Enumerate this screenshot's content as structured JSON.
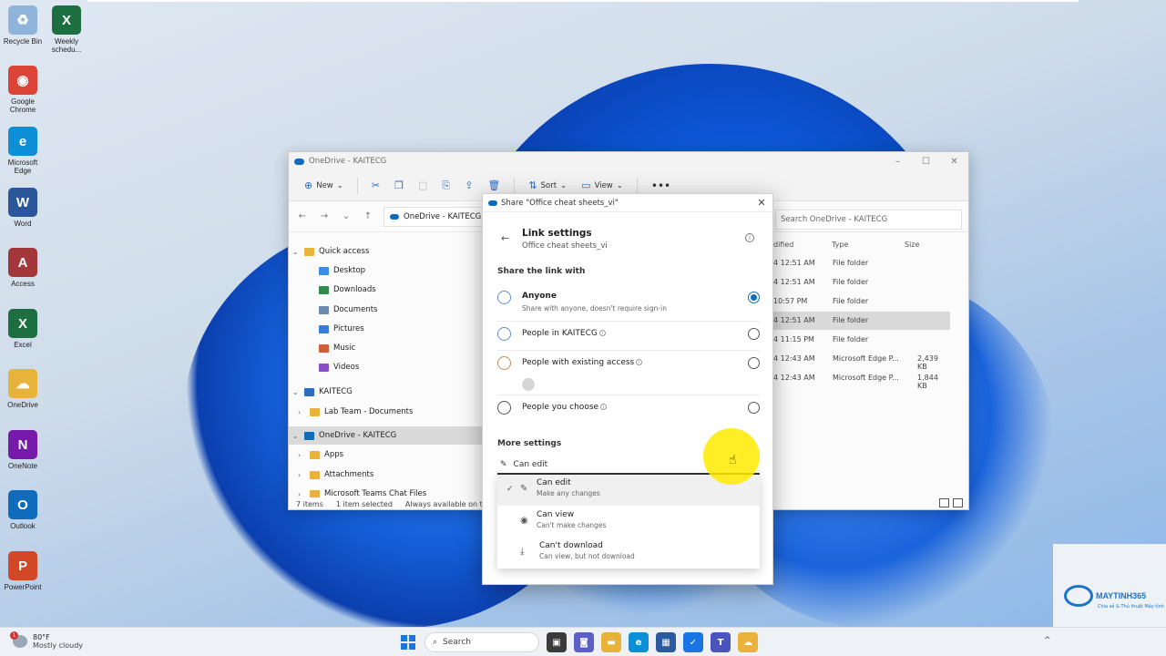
{
  "desktop_icons": [
    {
      "label": "Recycle Bin",
      "icon": "recycle-bin-icon",
      "color": "#8fb3d9",
      "glyph": "♻"
    },
    {
      "label": "Weekly schedu...",
      "icon": "excel-file-icon",
      "color": "#1d6f42",
      "glyph": "X"
    },
    {
      "label": "Google Chrome",
      "icon": "chrome-icon",
      "color": "#db4437",
      "glyph": "◉"
    },
    {
      "label": "Microsoft Edge",
      "icon": "edge-icon",
      "color": "#0c8fd6",
      "glyph": "e"
    },
    {
      "label": "Word",
      "icon": "word-icon",
      "color": "#2b579a",
      "glyph": "W"
    },
    {
      "label": "Access",
      "icon": "access-icon",
      "color": "#a4373a",
      "glyph": "A"
    },
    {
      "label": "Excel",
      "icon": "excel-icon",
      "color": "#1d6f42",
      "glyph": "X"
    },
    {
      "label": "OneDrive",
      "icon": "onedrive-icon",
      "color": "#e8b33a",
      "glyph": "☁"
    },
    {
      "label": "OneNote",
      "icon": "onenote-icon",
      "color": "#7719aa",
      "glyph": "N"
    },
    {
      "label": "Outlook",
      "icon": "outlook-icon",
      "color": "#0f6cbd",
      "glyph": "O"
    },
    {
      "label": "PowerPoint",
      "icon": "powerpoint-icon",
      "color": "#d24726",
      "glyph": "P"
    }
  ],
  "explorer": {
    "title": "OneDrive - KAITECG",
    "commands": {
      "new": "New",
      "sort": "Sort",
      "view": "View"
    },
    "address": "OneDrive - KAITECG",
    "search_placeholder": "Search OneDrive - KAITECG",
    "nav": [
      {
        "label": "Quick access",
        "chev": "v",
        "color": "#e8b33a"
      },
      {
        "label": "Desktop",
        "chev": "",
        "color": "#3a8ee6"
      },
      {
        "label": "Downloads",
        "chev": "",
        "color": "#2f8a4c"
      },
      {
        "label": "Documents",
        "chev": "",
        "color": "#6c8ab0"
      },
      {
        "label": "Pictures",
        "chev": "",
        "color": "#3a7bd5"
      },
      {
        "label": "Music",
        "chev": "",
        "color": "#d35d3b"
      },
      {
        "label": "Videos",
        "chev": "",
        "color": "#8a4cc8"
      },
      {
        "label": "KAITECG",
        "chev": "v",
        "color": "#2b6cc4"
      },
      {
        "label": "Lab Team - Documents",
        "chev": ">",
        "color": "#e8b33a"
      },
      {
        "label": "OneDrive - KAITECG",
        "chev": "v",
        "color": "#0f6cbd"
      },
      {
        "label": "Apps",
        "chev": ">",
        "color": "#e8b33a"
      },
      {
        "label": "Attachments",
        "chev": ">",
        "color": "#e8b33a"
      },
      {
        "label": "Microsoft Teams Chat Files",
        "chev": ">",
        "color": "#e8b33a"
      }
    ],
    "columns": {
      "modified": "dified",
      "type": "Type",
      "size": "Size"
    },
    "rows": [
      {
        "date": "4 12:51 AM",
        "type": "File folder",
        "size": ""
      },
      {
        "date": "4 12:51 AM",
        "type": "File folder",
        "size": ""
      },
      {
        "date": "10:57 PM",
        "type": "File folder",
        "size": ""
      },
      {
        "date": "4 12:51 AM",
        "type": "File folder",
        "size": ""
      },
      {
        "date": "4 11:15 PM",
        "type": "File folder",
        "size": ""
      },
      {
        "date": "4 12:43 AM",
        "type": "Microsoft Edge P...",
        "size": "2,439 KB"
      },
      {
        "date": "4 12:43 AM",
        "type": "Microsoft Edge P...",
        "size": "1,844 KB"
      }
    ],
    "status": {
      "items": "7 items",
      "selected": "1 item selected",
      "availability": "Always available on this dev"
    }
  },
  "share": {
    "title": "Share \"Office cheat sheets_vi\"",
    "heading": "Link settings",
    "subheading": "Office cheat sheets_vi",
    "section_share": "Share the link with",
    "options": [
      {
        "label": "Anyone",
        "sub": "Share with anyone, doesn't require sign-in"
      },
      {
        "label": "People in KAITECG",
        "sub": ""
      },
      {
        "label": "People with existing access",
        "sub": ""
      },
      {
        "label": "People you choose",
        "sub": ""
      }
    ],
    "section_more": "More settings",
    "permission_value": "Can edit",
    "menu": [
      {
        "label": "Can edit",
        "sub": "Make any changes"
      },
      {
        "label": "Can view",
        "sub": "Can't make changes"
      },
      {
        "label": "Can't download",
        "sub": "Can view, but not download"
      }
    ]
  },
  "taskbar": {
    "weather_temp": "80°F",
    "weather_desc": "Mostly cloudy",
    "weather_badge": "1",
    "search_label": "Search"
  },
  "watermark": {
    "brand": "MAYTINH365",
    "tagline": "Chia sẻ & Thủ thuật Máy tính"
  },
  "colors": {
    "accent": "#0f6cbd",
    "cursor_highlight": "#ffeb00"
  }
}
